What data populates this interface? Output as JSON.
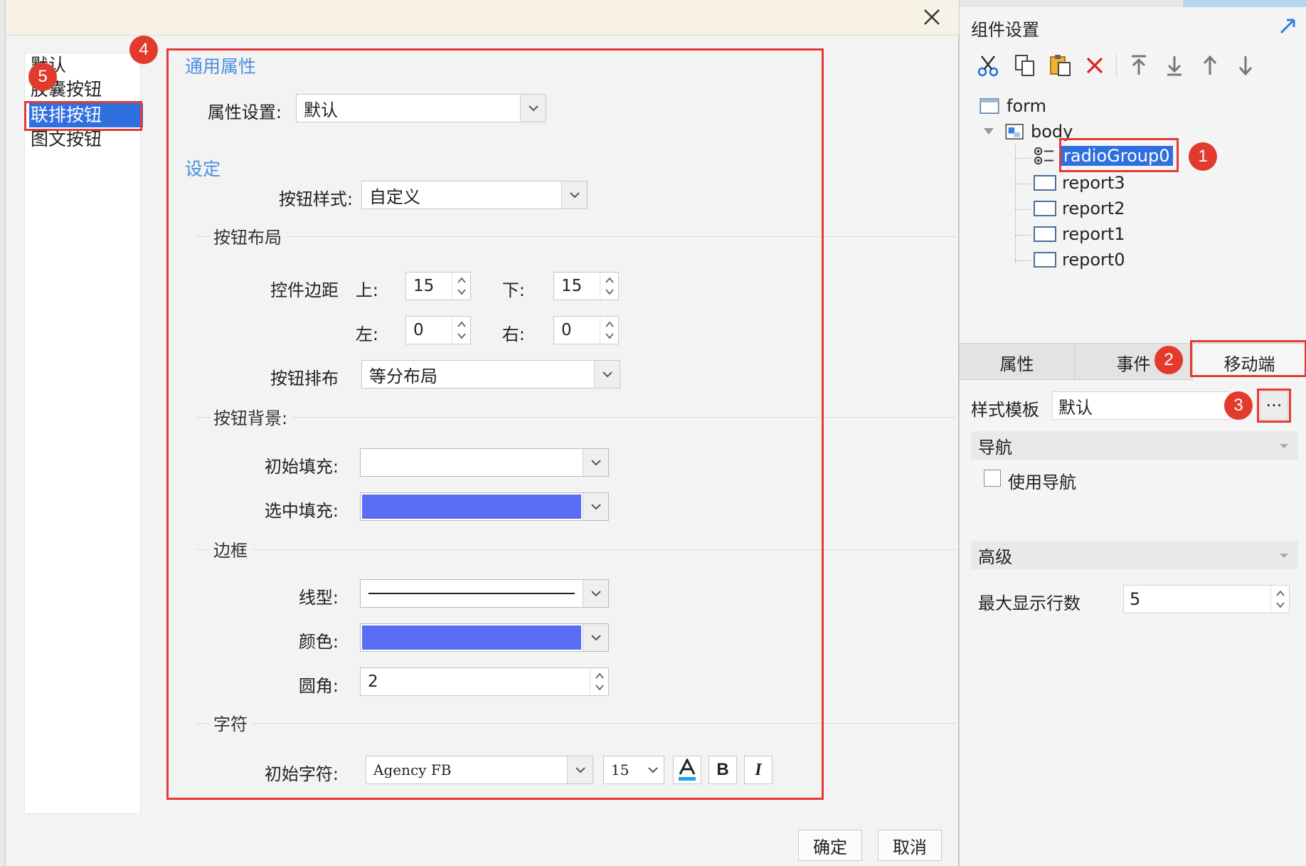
{
  "dialog": {
    "style_list": [
      "默认",
      "胶囊按钮",
      "联排按钮",
      "图文按钮"
    ],
    "selected_style_index": 2,
    "sections": {
      "general": "通用属性",
      "settings": "设定"
    },
    "property_setting": {
      "label": "属性设置:",
      "value": "默认"
    },
    "button_style": {
      "label": "按钮样式:",
      "value": "自定义"
    },
    "button_layout": {
      "group": "按钮布局",
      "margin_label": "控件边距",
      "top_label": "上:",
      "top": "15",
      "bottom_label": "下:",
      "bottom": "15",
      "left_label": "左:",
      "left": "0",
      "right_label": "右:",
      "right": "0",
      "arrangement_label": "按钮排布",
      "arrangement": "等分布局"
    },
    "button_bg": {
      "group": "按钮背景:",
      "initial_fill_label": "初始填充:",
      "initial_fill_color": "#ffffff",
      "selected_fill_label": "选中填充:",
      "selected_fill_color": "#5a6ef5"
    },
    "border": {
      "group": "边框",
      "line_label": "线型:",
      "color_label": "颜色:",
      "color": "#5a6ef5",
      "radius_label": "圆角:",
      "radius": "2"
    },
    "chars": {
      "group": "字符",
      "initial_label": "初始字符:",
      "font": "Agency FB",
      "size": "15",
      "bold": "B",
      "italic": "I"
    },
    "ok_button": "确定",
    "cancel_button": "取消"
  },
  "right_panel": {
    "title": "组件设置",
    "toolbar": [
      "cut-icon",
      "copy-icon",
      "paste-icon",
      "delete-icon",
      "move-top-icon",
      "move-bottom-icon",
      "move-up-icon",
      "move-down-icon"
    ],
    "tree": {
      "form": "form",
      "body": "body",
      "children": [
        "radioGroup0",
        "report3",
        "report2",
        "report1",
        "report0"
      ]
    },
    "tabs": [
      "属性",
      "事件",
      "移动端"
    ],
    "active_tab_index": 2,
    "style_template": {
      "label": "样式模板",
      "value": "默认",
      "more": "···"
    },
    "navigation": {
      "section": "导航",
      "use_nav": "使用导航"
    },
    "advanced": {
      "section": "高级",
      "max_rows_label": "最大显示行数",
      "max_rows": "5"
    }
  },
  "badges": [
    "1",
    "2",
    "3",
    "4",
    "5"
  ],
  "colors": {
    "accent_blue": "#2f6fe0",
    "annotation_red": "#e53935",
    "section_blue": "#4a8fe2"
  }
}
